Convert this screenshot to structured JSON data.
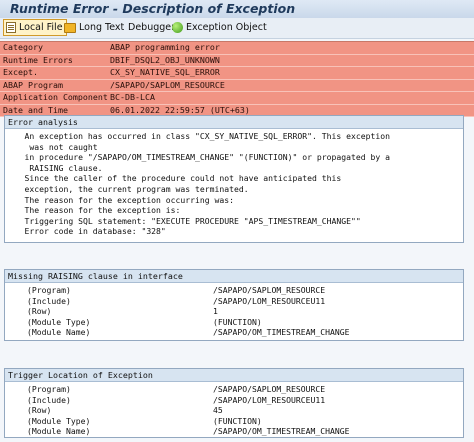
{
  "window": {
    "title": "Runtime Error - Description of Exception"
  },
  "toolbar": {
    "local_file": "Local File",
    "long_text": "Long Text",
    "debugger": "Debugger",
    "exception_object": "Exception Object"
  },
  "header_rows": [
    {
      "key": "Category",
      "value": "ABAP programming error"
    },
    {
      "key": "Runtime Errors",
      "value": "DBIF_DSQL2_OBJ_UNKNOWN"
    },
    {
      "key": "Except.",
      "value": "CX_SY_NATIVE_SQL_ERROR"
    },
    {
      "key": "ABAP Program",
      "value": "/SAPAPO/SAPLOM_RESOURCE"
    },
    {
      "key": "Application Component",
      "value": "BC-DB-LCA"
    },
    {
      "key": "Date and Time",
      "value": "06.01.2022 22:59:57 (UTC+63)"
    }
  ],
  "error_analysis": {
    "title": "Error analysis",
    "lines": [
      "    An exception has occurred in class \"CX_SY_NATIVE_SQL_ERROR\". This exception",
      "     was not caught",
      "    in procedure \"/SAPAPO/OM_TIMESTREAM_CHANGE\" \"(FUNCTION)\" or propagated by a",
      "     RAISING clause.",
      "    Since the caller of the procedure could not have anticipated this",
      "    exception, the current program was terminated.",
      "    The reason for the exception occurring was:",
      "    The reason for the exception is:",
      "    Triggering SQL statement: \"EXECUTE PROCEDURE \"APS_TIMESTREAM_CHANGE\"\"",
      "    Error code in database: \"328\""
    ]
  },
  "missing_raising": {
    "title": "Missing RAISING clause in interface",
    "rows": [
      {
        "key": "(Program)",
        "value": "/SAPAPO/SAPLOM_RESOURCE"
      },
      {
        "key": "(Include)",
        "value": "/SAPAPO/LOM_RESOURCEU11"
      },
      {
        "key": "(Row)",
        "value": "1"
      },
      {
        "key": "(Module Type)",
        "value": "(FUNCTION)"
      },
      {
        "key": "(Module Name)",
        "value": "/SAPAPO/OM_TIMESTREAM_CHANGE"
      }
    ]
  },
  "trigger_location": {
    "title": "Trigger Location of Exception",
    "rows": [
      {
        "key": "(Program)",
        "value": "/SAPAPO/SAPLOM_RESOURCE"
      },
      {
        "key": "(Include)",
        "value": "/SAPAPO/LOM_RESOURCEU11"
      },
      {
        "key": "(Row)",
        "value": "45"
      },
      {
        "key": "(Module Type)",
        "value": "(FUNCTION)"
      },
      {
        "key": "(Module Name)",
        "value": "/SAPAPO/OM_TIMESTREAM_CHANGE"
      }
    ]
  },
  "colors": {
    "header_bg": "#f19484",
    "section_header_bg": "#d7e4f1",
    "title_text": "#1f3a5c"
  },
  "icons": {
    "local_file": "file-icon",
    "long_text": "long-text-icon",
    "exception_object": "exception-object-icon"
  }
}
